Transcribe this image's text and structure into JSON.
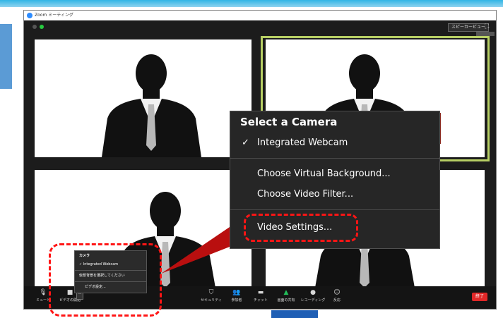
{
  "window": {
    "title": "Zoom ミーティング",
    "speaker_view": "スピーカービュー",
    "fullscreen": "⛶"
  },
  "camera_menu": {
    "title": "Select a Camera",
    "selected_camera": "Integrated Webcam",
    "check": "✓",
    "virtual_background": "Choose Virtual Background...",
    "video_filter": "Choose Video Filter...",
    "video_settings": "Video Settings..."
  },
  "mini_menu": {
    "header": "カメラ",
    "selected_camera": "✓ Integrated Webcam",
    "background": "仮想背景を選択してください",
    "video_settings": "ビデオ設定..."
  },
  "toolbar": {
    "mute": "ミュート",
    "stop_video": "ビデオの開始",
    "security": "セキュリティ",
    "participants": "参加者",
    "chat": "チャット",
    "share": "画面の共有",
    "record": "レコーディング",
    "reactions": "反応",
    "end": "終了"
  },
  "icons": {
    "mic": "🎙",
    "camera": "■",
    "shield": "⛉",
    "people": "👥",
    "chat": "▬",
    "share": "▲",
    "record": "●",
    "reaction": "☺"
  },
  "colors": {
    "active_speaker_border": "#b7cf64",
    "highlight": "#ff1515",
    "end_button": "#e02828",
    "share_green": "#22c05a"
  }
}
